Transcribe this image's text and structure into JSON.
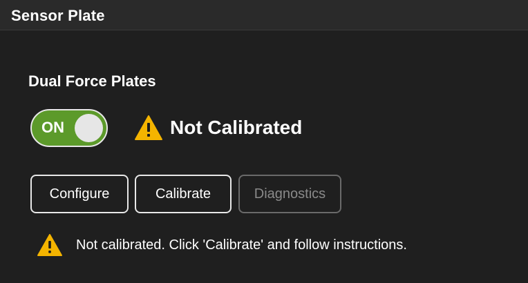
{
  "panel": {
    "title": "Sensor Plate"
  },
  "section": {
    "title": "Dual Force Plates"
  },
  "toggle": {
    "label": "ON",
    "state": "on",
    "color": "#5c9a2a"
  },
  "status": {
    "icon": "warning-icon",
    "text": "Not Calibrated",
    "icon_color": "#f4b400"
  },
  "buttons": {
    "configure": "Configure",
    "calibrate": "Calibrate",
    "diagnostics": "Diagnostics",
    "diagnostics_disabled": true
  },
  "message": {
    "icon": "warning-icon",
    "text": "Not calibrated. Click 'Calibrate' and follow instructions."
  }
}
